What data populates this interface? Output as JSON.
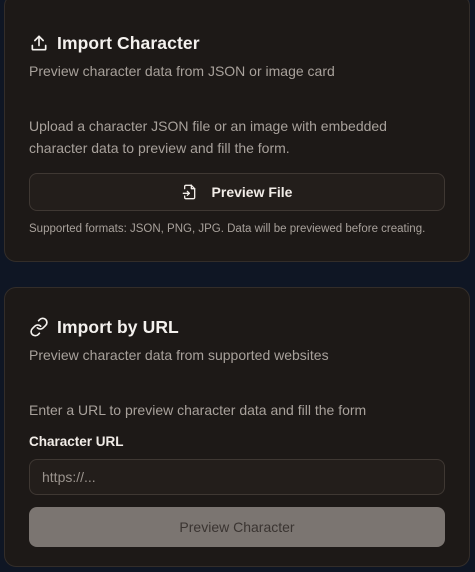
{
  "import_character": {
    "title": "Import Character",
    "title_icon": "upload-icon",
    "subtitle": "Preview character data from JSON or image card",
    "description": "Upload a character JSON file or an image with embedded character data to preview and fill the form.",
    "preview_button": {
      "label": "Preview File",
      "icon": "file-import-icon"
    },
    "hint": "Supported formats: JSON, PNG, JPG. Data will be previewed before creating."
  },
  "import_url": {
    "title": "Import by URL",
    "title_icon": "link-icon",
    "subtitle": "Preview character data from supported websites",
    "description": "Enter a URL to preview character data and fill the form",
    "field_label": "Character URL",
    "url_value": "",
    "url_placeholder": "https://...",
    "preview_button": {
      "label": "Preview Character",
      "disabled": true
    }
  },
  "colors": {
    "page_background": "#0f1624",
    "card_background": "#1d1917",
    "card_border": "#332d29",
    "text_primary": "#f4f1ee",
    "text_muted": "#a8a19b",
    "disabled_button": "#7b7571"
  }
}
